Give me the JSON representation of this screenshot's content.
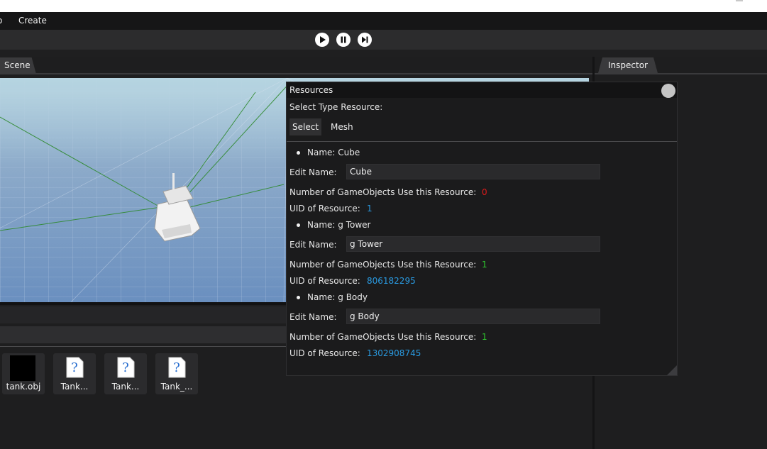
{
  "menu": {
    "items": [
      {
        "label": "o"
      },
      {
        "label": "Create"
      }
    ]
  },
  "toolbar": {
    "buttons": [
      {
        "icon": "play-icon"
      },
      {
        "icon": "pause-icon"
      },
      {
        "icon": "step-icon"
      }
    ]
  },
  "scene": {
    "tab_label": "Scene"
  },
  "inspector": {
    "tab_label": "Inspector"
  },
  "assets": [
    {
      "name": "tank.obj",
      "icon": "black-thumbnail-icon"
    },
    {
      "name": "Tank...",
      "icon": "unknown-file-icon"
    },
    {
      "name": "Tank...",
      "icon": "unknown-file-icon"
    },
    {
      "name": "Tank_...",
      "icon": "unknown-file-icon"
    }
  ],
  "resources": {
    "title": "Resources",
    "select_type_label": "Select Type Resource:",
    "select_button": "Select",
    "mesh_button": "Mesh",
    "edit_name_label": "Edit Name:",
    "usage_label": "Number of GameObjects Use this Resource:",
    "uid_label": "UID of Resource:",
    "items": [
      {
        "name": "Name: Cube",
        "edit_value": "Cube",
        "usage": "0",
        "uid": "1"
      },
      {
        "name": "Name: g Tower",
        "edit_value": "g Tower",
        "usage": "1",
        "uid": "806182295"
      },
      {
        "name": "Name: g Body",
        "edit_value": "g Body",
        "usage": "1",
        "uid": "1302908745"
      }
    ]
  },
  "colors": {
    "usage_zero": "#e01b1b",
    "usage_positive": "#2ec72e",
    "uid": "#2a9ae0"
  }
}
